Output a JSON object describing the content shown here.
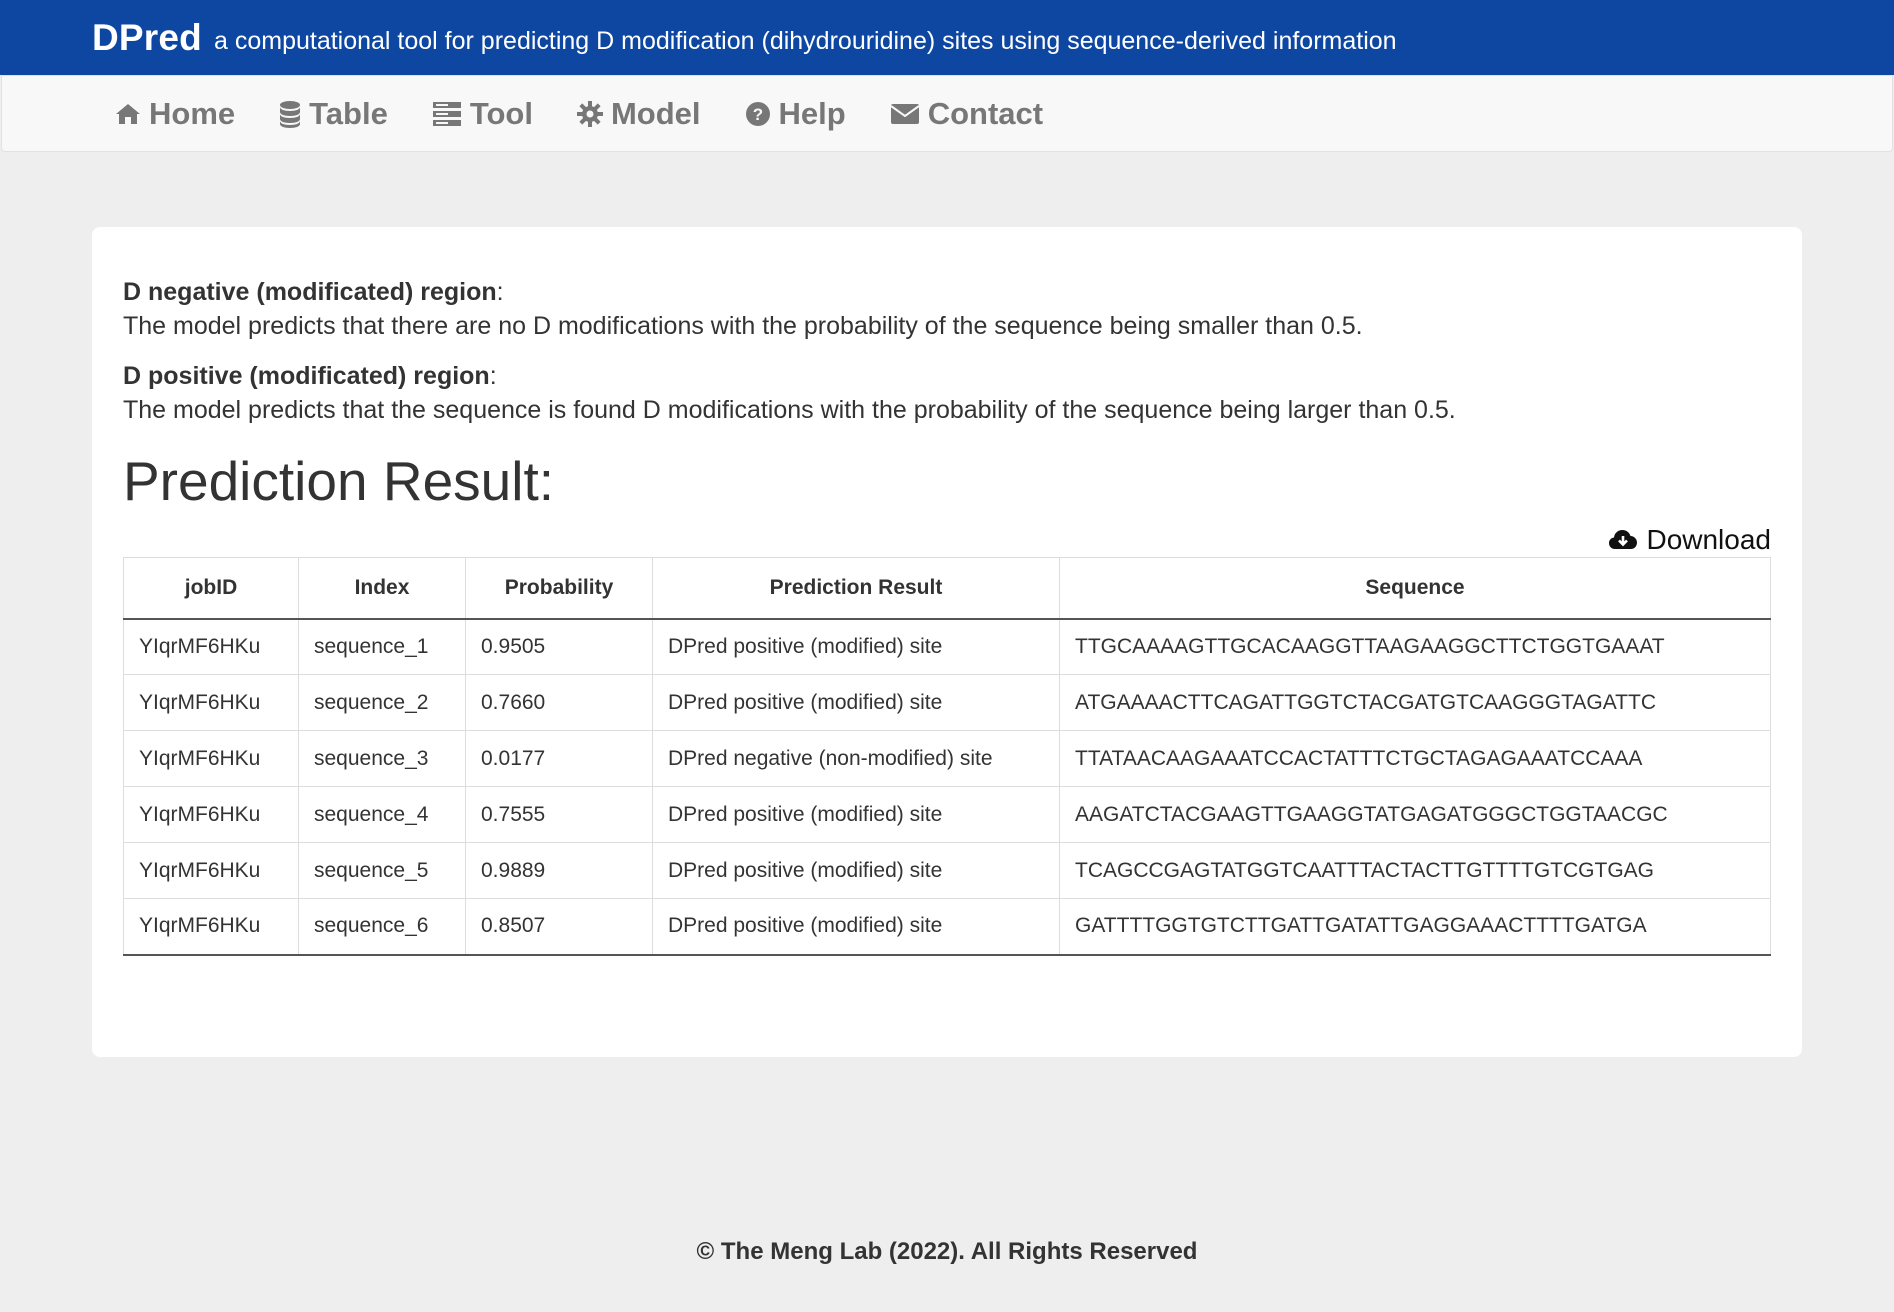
{
  "header": {
    "brand": "DPred",
    "tagline": "a computational tool for predicting D modification (dihydrouridine) sites using sequence-derived information"
  },
  "nav": {
    "items": [
      {
        "label": "Home",
        "icon": "home-icon"
      },
      {
        "label": "Table",
        "icon": "database-icon"
      },
      {
        "label": "Tool",
        "icon": "server-icon"
      },
      {
        "label": "Model",
        "icon": "gear-icon"
      },
      {
        "label": "Help",
        "icon": "question-circle-icon"
      },
      {
        "label": "Contact",
        "icon": "envelope-icon"
      }
    ]
  },
  "legend": {
    "negative_title": "D negative (modificated) region",
    "negative_text": "The model predicts that there are no D modifications with the probability of the sequence being smaller than 0.5.",
    "positive_title": "D positive (modificated) region",
    "positive_text": "The model predicts that the sequence is found D modifications with the probability of the sequence being larger than 0.5."
  },
  "results": {
    "heading": "Prediction Result:",
    "download_label": "Download",
    "columns": [
      "jobID",
      "Index",
      "Probability",
      "Prediction Result",
      "Sequence"
    ],
    "rows": [
      [
        "YIqrMF6HKu",
        "sequence_1",
        "0.9505",
        "DPred positive (modified) site",
        "TTGCAAAAGTTGCACAAGGTTAAGAAGGCTTCTGGTGAAAT"
      ],
      [
        "YIqrMF6HKu",
        "sequence_2",
        "0.7660",
        "DPred positive (modified) site",
        "ATGAAAACTTCAGATTGGTCTACGATGTCAAGGGTAGATTC"
      ],
      [
        "YIqrMF6HKu",
        "sequence_3",
        "0.0177",
        "DPred negative (non-modified) site",
        "TTATAACAAGAAATCCACTATTTCTGCTAGAGAAATCCAAA"
      ],
      [
        "YIqrMF6HKu",
        "sequence_4",
        "0.7555",
        "DPred positive (modified) site",
        "AAGATCTACGAAGTTGAAGGTATGAGATGGGCTGGTAACGC"
      ],
      [
        "YIqrMF6HKu",
        "sequence_5",
        "0.9889",
        "DPred positive (modified) site",
        "TCAGCCGAGTATGGTCAATTTACTACTTGTTTTGTCGTGAG"
      ],
      [
        "YIqrMF6HKu",
        "sequence_6",
        "0.8507",
        "DPred positive (modified) site",
        "GATTTTGGTGTCTTGATTGATATTGAGGAAACTTTTGATGA"
      ]
    ]
  },
  "footer": {
    "text": "© The Meng Lab (2022). All Rights Reserved"
  },
  "colors": {
    "header_bg": "#0d47a1",
    "nav_text": "#777777",
    "page_bg": "#eeeeee"
  }
}
